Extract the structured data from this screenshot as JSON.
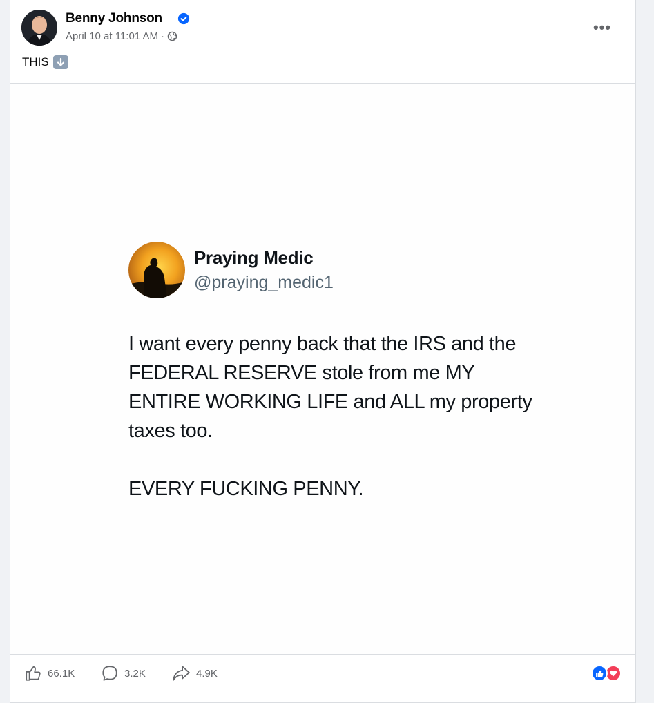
{
  "post": {
    "author_name": "Benny Johnson",
    "timestamp": "April 10 at 11:01 AM",
    "separator": "·",
    "privacy_icon": "globe-icon",
    "more_icon": "more-horizontal-icon",
    "more_label": "•••",
    "text": "THIS",
    "emoji": "down-arrow-emoji"
  },
  "embedded_tweet": {
    "name": "Praying Medic",
    "handle": "@praying_medic1",
    "paragraphs": [
      "I want every penny back that the IRS and the FEDERAL RESERVE stole from me MY ENTIRE WORKING LIFE and ALL my property taxes too.",
      "EVERY FUCKING PENNY."
    ]
  },
  "footer": {
    "likes": "66.1K",
    "comments": "3.2K",
    "shares": "4.9K",
    "reactions": [
      "like-reaction-icon",
      "love-reaction-icon"
    ]
  },
  "colors": {
    "verified": "#0866ff",
    "like": "#0866ff",
    "love": "#f33e58",
    "muted_text": "#65676b"
  }
}
